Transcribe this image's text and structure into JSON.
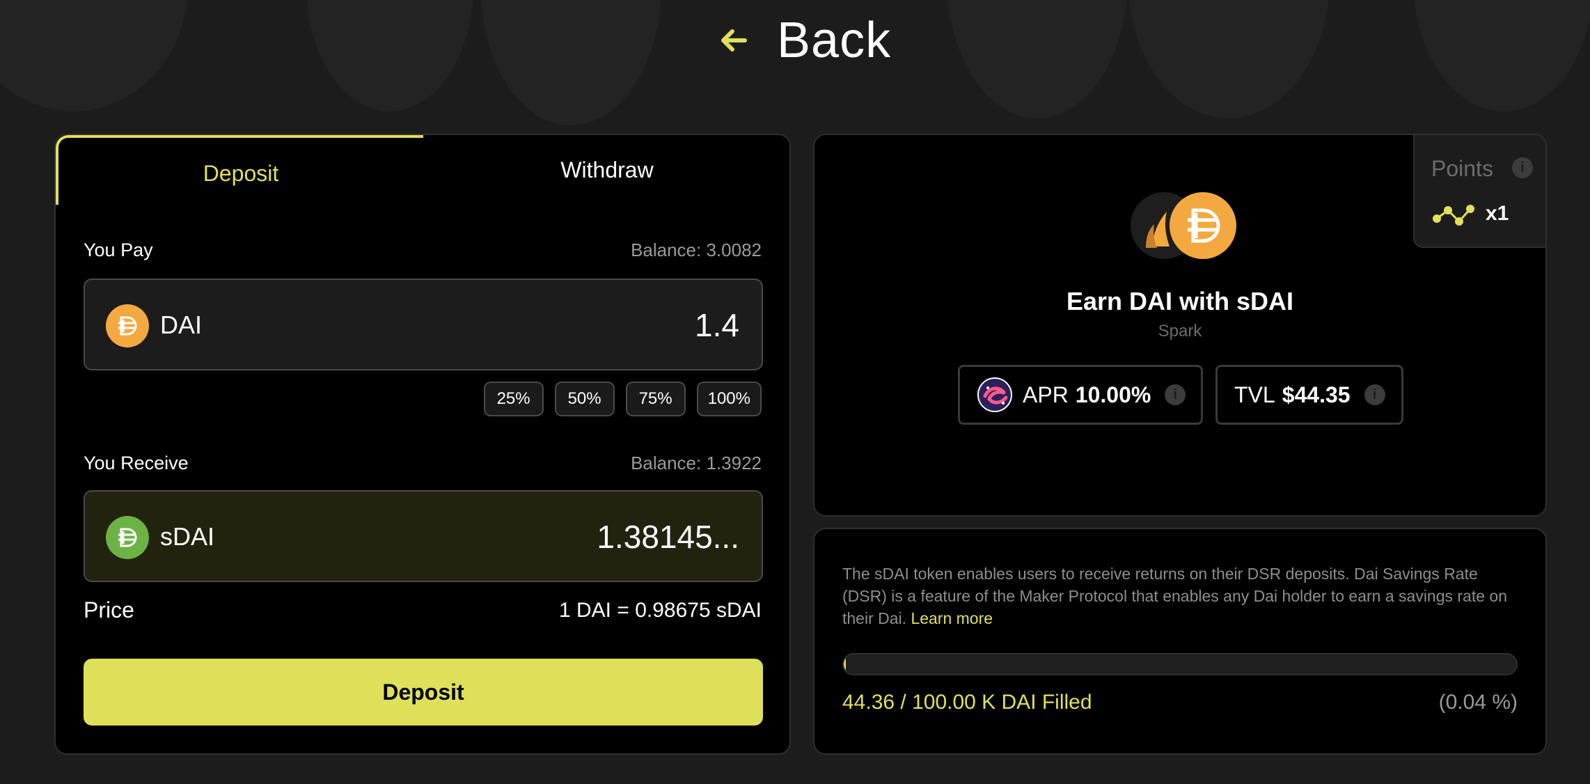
{
  "nav": {
    "back_label": "Back"
  },
  "tabs": [
    {
      "label": "Deposit",
      "active": true
    },
    {
      "label": "Withdraw",
      "active": false
    }
  ],
  "pay": {
    "label": "You Pay",
    "balance": "Balance: 3.0082",
    "token": "DAI",
    "amount": "1.4",
    "icon": "dai-icon",
    "icon_color": "#f4a940"
  },
  "percent_buttons": [
    "25%",
    "50%",
    "75%",
    "100%"
  ],
  "receive": {
    "label": "You Receive",
    "balance": "Balance: 1.3922",
    "token": "sDAI",
    "amount": "1.38145...",
    "icon": "sdai-icon",
    "icon_color": "#6db244"
  },
  "price": {
    "label": "Price",
    "value": "1 DAI = 0.98675 sDAI"
  },
  "deposit_button": "Deposit",
  "points": {
    "label": "Points",
    "multiplier": "x1"
  },
  "pool": {
    "title": "Earn DAI with sDAI",
    "protocol": "Spark",
    "apr_label": "APR",
    "apr_value": "10.00%",
    "tvl_label": "TVL",
    "tvl_value": "$44.35"
  },
  "description": {
    "text": "The sDAI token enables users to receive returns on their DSR deposits. Dai Savings Rate (DSR) is a feature of the Maker Protocol that enables any Dai holder to earn a savings rate on their Dai.",
    "link": "Learn more"
  },
  "fill": {
    "status": "44.36 / 100.00 K DAI Filled",
    "percent_text": "(0.04 %)",
    "progress_fraction": 0.0004
  },
  "colors": {
    "accent": "#e0e05c",
    "background": "#1c1c1c",
    "panel": "#000000"
  }
}
